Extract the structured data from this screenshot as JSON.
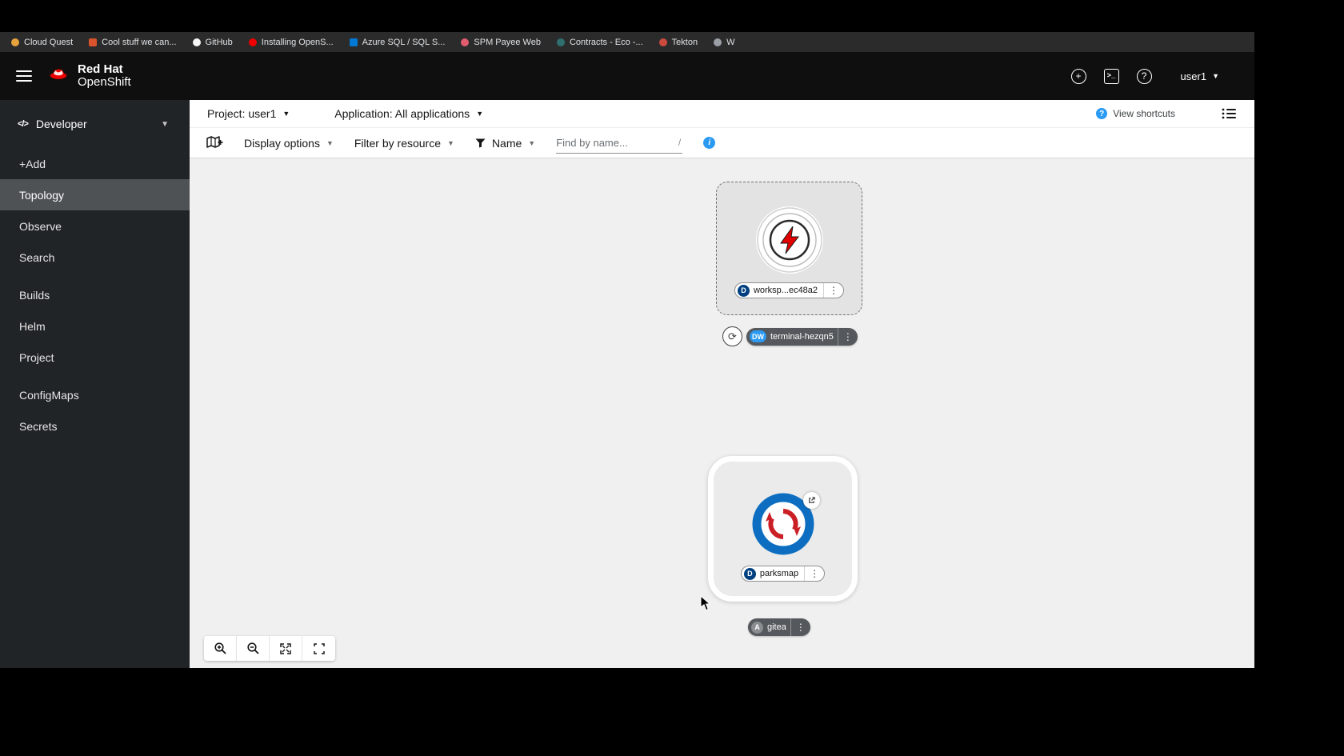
{
  "icons": {
    "kebab": "⋮",
    "caret": "▾",
    "plus": "+",
    "terminal_prompt": ">_",
    "help": "?",
    "question": "?",
    "info": "i",
    "code": "</>",
    "refresh": "⟳"
  },
  "bookmarks": {
    "items": [
      {
        "label": "Cloud Quest",
        "color": "#e8a33d"
      },
      {
        "label": "Cool stuff we can...",
        "color": "#d9532c"
      },
      {
        "label": "GitHub",
        "color": "#f5f5f5"
      },
      {
        "label": "Installing OpenS...",
        "color": "#ee0000"
      },
      {
        "label": "Azure SQL / SQL S...",
        "color": "#0078d4"
      },
      {
        "label": "SPM Payee Web",
        "color": "#e05c6e"
      },
      {
        "label": "Contracts - Eco -...",
        "color": "#2f6f6f"
      },
      {
        "label": "Tekton",
        "color": "#cd4a3e"
      },
      {
        "label": "W",
        "color": "#9aa0a6"
      }
    ]
  },
  "masthead": {
    "brand_line1": "Red Hat",
    "brand_line2": "OpenShift",
    "user_menu": "user1"
  },
  "sidebar": {
    "perspective": "Developer",
    "items": [
      {
        "label": "+Add"
      },
      {
        "label": "Topology",
        "selected": true
      },
      {
        "label": "Observe"
      },
      {
        "label": "Search"
      },
      {
        "label": "Builds"
      },
      {
        "label": "Helm"
      },
      {
        "label": "Project"
      },
      {
        "label": "ConfigMaps"
      },
      {
        "label": "Secrets"
      }
    ]
  },
  "context_bar": {
    "project": "Project: user1",
    "application": "Application: All applications",
    "view_shortcuts": "View shortcuts"
  },
  "filter_bar": {
    "display_options": "Display options",
    "filter_by_resource": "Filter by resource",
    "name_filter": "Name",
    "find_placeholder": "Find by name...",
    "shortcut_hint": "/"
  },
  "topology": {
    "workspace_node": {
      "badge": "D",
      "label": "worksp...ec48a2"
    },
    "terminal_pill": {
      "badge": "DW",
      "label": "terminal-hezqn5"
    },
    "parksmap_node": {
      "badge": "D",
      "label": "parksmap"
    },
    "gitea_pill": {
      "badge": "A",
      "label": "gitea"
    },
    "badge_colors": {
      "D": "#004080",
      "DW": "#2b9af3",
      "A": "#8a8d90"
    }
  }
}
